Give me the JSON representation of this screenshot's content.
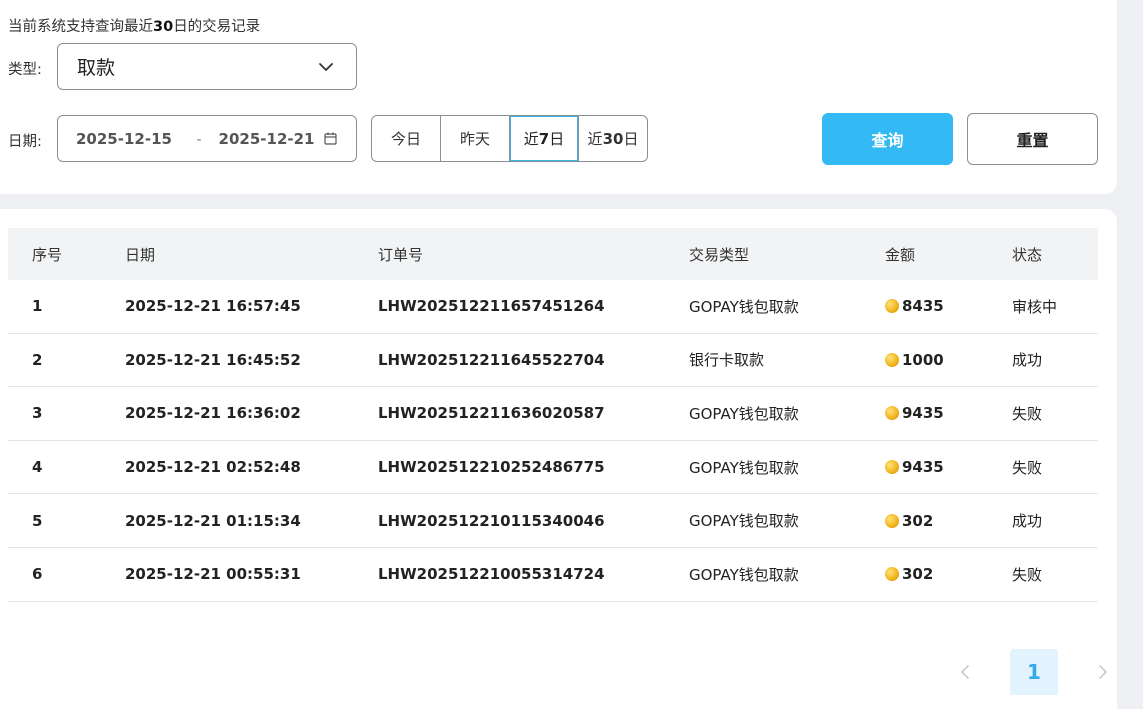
{
  "filters": {
    "hint_prefix": "当前系统支持查询最近",
    "hint_days": "30",
    "hint_suffix": "日的交易记录",
    "type_label": "类型:",
    "type_value": "取款",
    "date_label": "日期:",
    "date_start": "2025-12-15",
    "date_sep": "-",
    "date_end": "2025-12-21",
    "quick": [
      {
        "pre": "今日",
        "num": "",
        "post": ""
      },
      {
        "pre": "昨天",
        "num": "",
        "post": ""
      },
      {
        "pre": "近",
        "num": "7",
        "post": "日"
      },
      {
        "pre": "近",
        "num": "30",
        "post": "日"
      }
    ],
    "query_label": "查询",
    "reset_label": "重置"
  },
  "table": {
    "headers": [
      "序号",
      "日期",
      "订单号",
      "交易类型",
      "金额",
      "状态"
    ],
    "rows": [
      [
        "1",
        "2025-12-21 16:57:45",
        "LHW202512211657451264",
        "GOPAY钱包取款",
        "8435",
        "审核中"
      ],
      [
        "2",
        "2025-12-21 16:45:52",
        "LHW202512211645522704",
        "银行卡取款",
        "1000",
        "成功"
      ],
      [
        "3",
        "2025-12-21 16:36:02",
        "LHW202512211636020587",
        "GOPAY钱包取款",
        "9435",
        "失败"
      ],
      [
        "4",
        "2025-12-21 02:52:48",
        "LHW202512210252486775",
        "GOPAY钱包取款",
        "9435",
        "失败"
      ],
      [
        "5",
        "2025-12-21 01:15:34",
        "LHW202512210115340046",
        "GOPAY钱包取款",
        "302",
        "成功"
      ],
      [
        "6",
        "2025-12-21 00:55:31",
        "LHW202512210055314724",
        "GOPAY钱包取款",
        "302",
        "失败"
      ]
    ]
  },
  "pagination": {
    "current": "1",
    "prev_icon": "chevron-left-icon",
    "next_icon": "chevron-right-icon"
  },
  "colors": {
    "accent": "#33b9f3",
    "page_bg": "#eef0f3",
    "header_bg": "#f2f3f5",
    "active_page_bg": "#e3f3fd"
  }
}
